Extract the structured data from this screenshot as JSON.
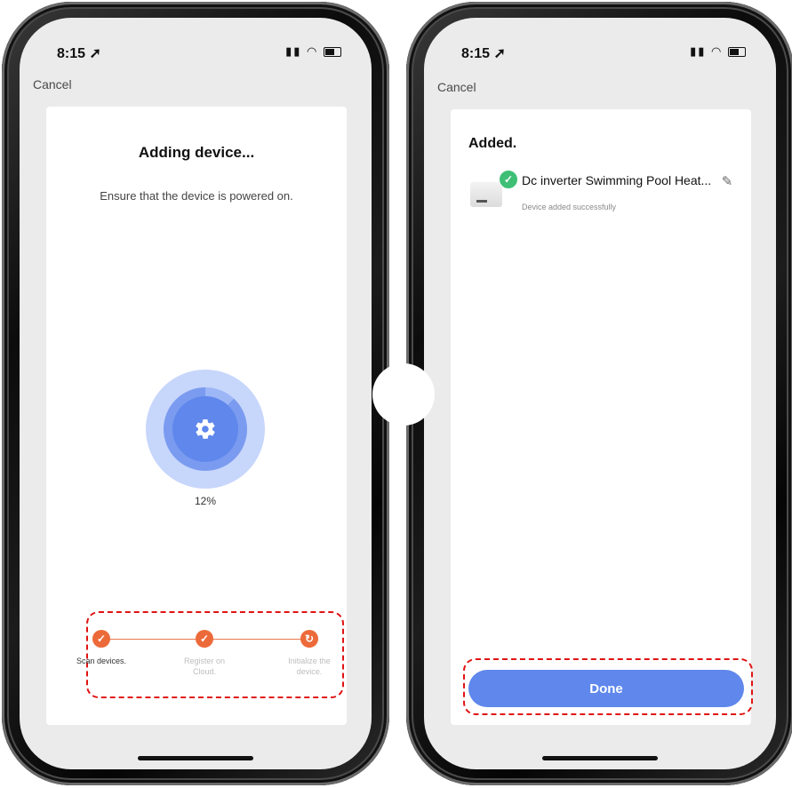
{
  "left_screen": {
    "status": {
      "time": "8:15"
    },
    "cancel": "Cancel",
    "title": "Adding device...",
    "subtitle": "Ensure that the device is powered on.",
    "progress_percent": "12%",
    "progress_value": 0.12,
    "steps": [
      {
        "label": "Scan devices.",
        "state": "done"
      },
      {
        "label": "Register on Cloud.",
        "state": "done"
      },
      {
        "label": "Initialize the device.",
        "state": "in-progress"
      }
    ]
  },
  "right_screen": {
    "status": {
      "time": "8:15"
    },
    "cancel": "Cancel",
    "title": "Added.",
    "device": {
      "name": "Dc inverter Swimming Pool Heat...",
      "status": "Device added successfully"
    },
    "done_label": "Done"
  },
  "colors": {
    "accent_blue": "#5f87ec",
    "step_orange": "#ec6a39",
    "success_green": "#3fbf76",
    "highlight_red": "#e01313"
  },
  "icons": [
    "gear-icon",
    "check-icon",
    "refresh-icon",
    "edit-pencil-icon",
    "location-arrow-icon",
    "wifi-icon",
    "battery-icon",
    "signal-icon"
  ]
}
